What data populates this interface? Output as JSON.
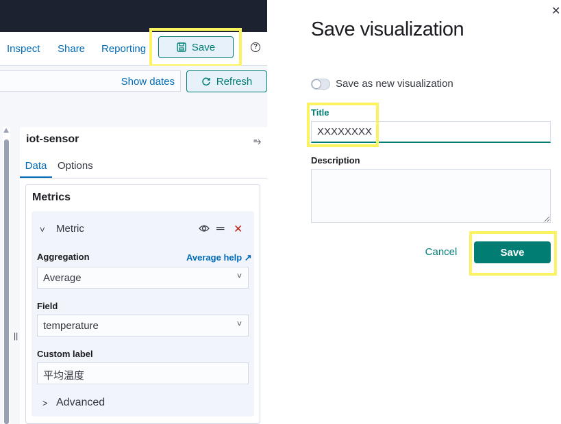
{
  "header": {
    "links": [
      "Inspect",
      "Share",
      "Reporting"
    ],
    "save_label": "Save",
    "help_icon": "?"
  },
  "querybar": {
    "show_dates_label": "Show dates",
    "refresh_label": "Refresh"
  },
  "editor": {
    "index_name": "iot-sensor",
    "tabs": [
      "Data",
      "Options"
    ],
    "metrics_title": "Metrics",
    "metric": {
      "label": "Metric",
      "aggregation_label": "Aggregation",
      "aggregation_help": "Average help",
      "aggregation_value": "Average",
      "field_label": "Field",
      "field_value": "temperature",
      "custom_label_label": "Custom label",
      "custom_label_value": "平均温度",
      "advanced_label": "Advanced"
    }
  },
  "modal": {
    "title": "Save visualization",
    "toggle_label": "Save as new visualization",
    "title_label": "Title",
    "title_value": "XXXXXXXX",
    "description_label": "Description",
    "description_value": "",
    "cancel_label": "Cancel",
    "save_label": "Save"
  },
  "colors": {
    "accent": "#017d73",
    "link": "#006bb8",
    "highlight": "#fbf460",
    "danger": "#bd271e"
  }
}
